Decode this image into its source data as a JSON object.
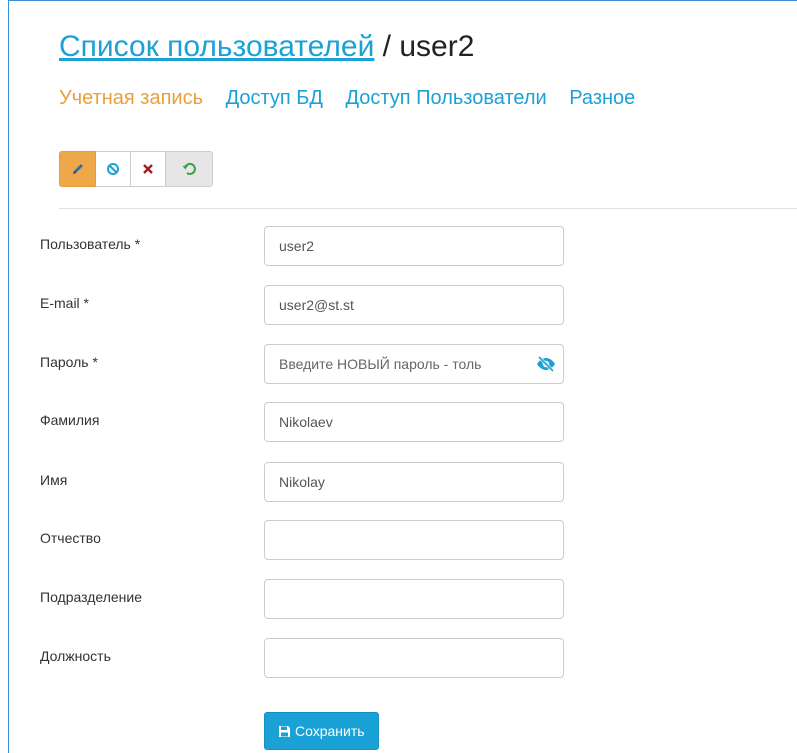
{
  "header": {
    "breadcrumb_link": "Список пользователей",
    "separator": "/",
    "current": "user2"
  },
  "tabs": [
    {
      "label": "Учетная запись",
      "active": true
    },
    {
      "label": "Доступ БД",
      "active": false
    },
    {
      "label": "Доступ Пользователи",
      "active": false
    },
    {
      "label": "Разное",
      "active": false
    }
  ],
  "toolbar": {
    "edit_icon": "pencil-icon",
    "cancel_icon": "ban-icon",
    "delete_icon": "times-icon",
    "reset_icon": "undo-icon"
  },
  "form": {
    "username": {
      "label": "Пользователь *",
      "value": "user2"
    },
    "email": {
      "label": "E-mail *",
      "value": "user2@st.st"
    },
    "password": {
      "label": "Пароль *",
      "value": "",
      "placeholder": "Введите НОВЫЙ пароль - толь",
      "icon": "eye-slash-icon"
    },
    "lastname": {
      "label": "Фамилия",
      "value": "Nikolaev"
    },
    "firstname": {
      "label": "Имя",
      "value": "Nikolay"
    },
    "patronymic": {
      "label": "Отчество",
      "value": ""
    },
    "department": {
      "label": "Подразделение",
      "value": ""
    },
    "position": {
      "label": "Должность",
      "value": ""
    }
  },
  "save_button": {
    "label": "Сохранить",
    "icon": "floppy-icon"
  },
  "colors": {
    "link": "#1aa1d6",
    "active_tab": "#e8a13a",
    "edit_button": "#eea84a",
    "delete": "#a11d1d",
    "reset": "#3aa14a",
    "save_button": "#1aa1d6"
  }
}
